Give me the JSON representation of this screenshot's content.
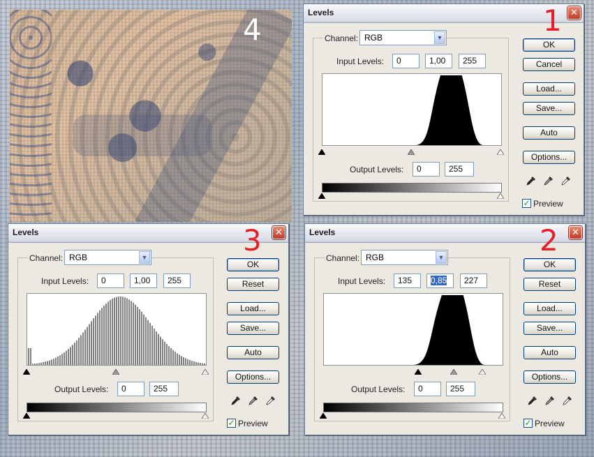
{
  "photo": {
    "label": "4"
  },
  "dialogs": [
    {
      "title": "Levels",
      "number": "1",
      "channel_label": "Channel:",
      "channel_value": "RGB",
      "input_label": "Input Levels:",
      "input_values": [
        "0",
        "1,00",
        "255"
      ],
      "input_selected_index": -1,
      "output_label": "Output Levels:",
      "output_values": [
        "0",
        "255"
      ],
      "buttons": [
        "OK",
        "Cancel",
        "Load...",
        "Save...",
        "Auto",
        "Options..."
      ],
      "preview_label": "Preview",
      "preview_checked": true,
      "histogram": {
        "type": "peak",
        "start": 0.52,
        "end": 0.9,
        "plateau_start": 0.66,
        "plateau_end": 0.78
      },
      "sliders": {
        "black": 0.0,
        "gray": 0.5,
        "white": 1.0
      }
    },
    {
      "title": "Levels",
      "number": "2",
      "channel_label": "Channel:",
      "channel_value": "RGB",
      "input_label": "Input Levels:",
      "input_values": [
        "135",
        "0,85",
        "227"
      ],
      "input_selected_index": 1,
      "output_label": "Output Levels:",
      "output_values": [
        "0",
        "255"
      ],
      "buttons": [
        "OK",
        "Reset",
        "Load...",
        "Save...",
        "Auto",
        "Options..."
      ],
      "preview_label": "Preview",
      "preview_checked": true,
      "histogram": {
        "type": "peak",
        "start": 0.5,
        "end": 0.9,
        "plateau_start": 0.66,
        "plateau_end": 0.78
      },
      "sliders": {
        "black": 0.53,
        "gray": 0.73,
        "white": 0.89
      }
    },
    {
      "title": "Levels",
      "number": "3",
      "channel_label": "Channel:",
      "channel_value": "RGB",
      "input_label": "Input Levels:",
      "input_values": [
        "0",
        "1,00",
        "255"
      ],
      "input_selected_index": -1,
      "output_label": "Output Levels:",
      "output_values": [
        "0",
        "255"
      ],
      "buttons": [
        "OK",
        "Reset",
        "Load...",
        "Save...",
        "Auto",
        "Options..."
      ],
      "preview_label": "Preview",
      "preview_checked": true,
      "histogram": {
        "type": "comb",
        "start": 0.0,
        "end": 1.0,
        "peak": 0.52
      },
      "sliders": {
        "black": 0.0,
        "gray": 0.5,
        "white": 1.0
      }
    }
  ]
}
